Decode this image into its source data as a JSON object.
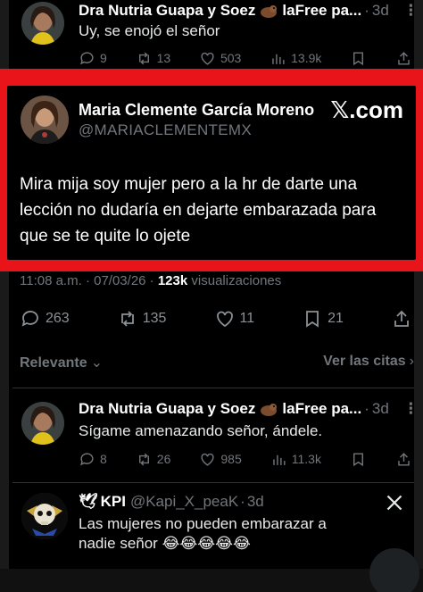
{
  "reply_top": {
    "name": "Dra Nutria Guapa y Soez",
    "name_suffix": "laFree pa...",
    "separator": "·",
    "time": "3d",
    "text": "Uy, se enojó el señor",
    "replies": "9",
    "reposts": "13",
    "likes": "503",
    "views": "13.9k"
  },
  "quoted": {
    "name": "Maria Clemente García Moreno",
    "handle": "@MARIACLEMENTEMX",
    "brand": "𝕏.com",
    "text": "Mira mija soy mujer pero a la hr de darte una lección no dudaría en dejarte embarazada para que se te quite lo ojete"
  },
  "meta": {
    "time": "11:08 a.m.",
    "sep": "·",
    "date": "07/03/26",
    "views_count": "123k",
    "views_label": "visualizaciones"
  },
  "main_actions": {
    "replies": "263",
    "reposts": "135",
    "likes": "11",
    "bookmarks": "21"
  },
  "sort": {
    "relevant": "Relevante",
    "quotes": "Ver las citas"
  },
  "reply_middle": {
    "name": "Dra Nutria Guapa y Soez",
    "name_suffix": "laFree pa...",
    "separator": "·",
    "time": "3d",
    "text": "Sígame amenazando señor, ándele.",
    "replies": "8",
    "reposts": "26",
    "likes": "985",
    "views": "11.3k"
  },
  "reply_bottom": {
    "name": "KPI",
    "handle": "@Kapi_X_peaK",
    "separator": "·",
    "time": "3d",
    "text": "Las mujeres no pueden embarazar a nadie señor 😂😂😂😂😂"
  },
  "colors": {
    "highlight_frame": "#e8141a",
    "muted": "#71767b",
    "background": "#000000"
  }
}
